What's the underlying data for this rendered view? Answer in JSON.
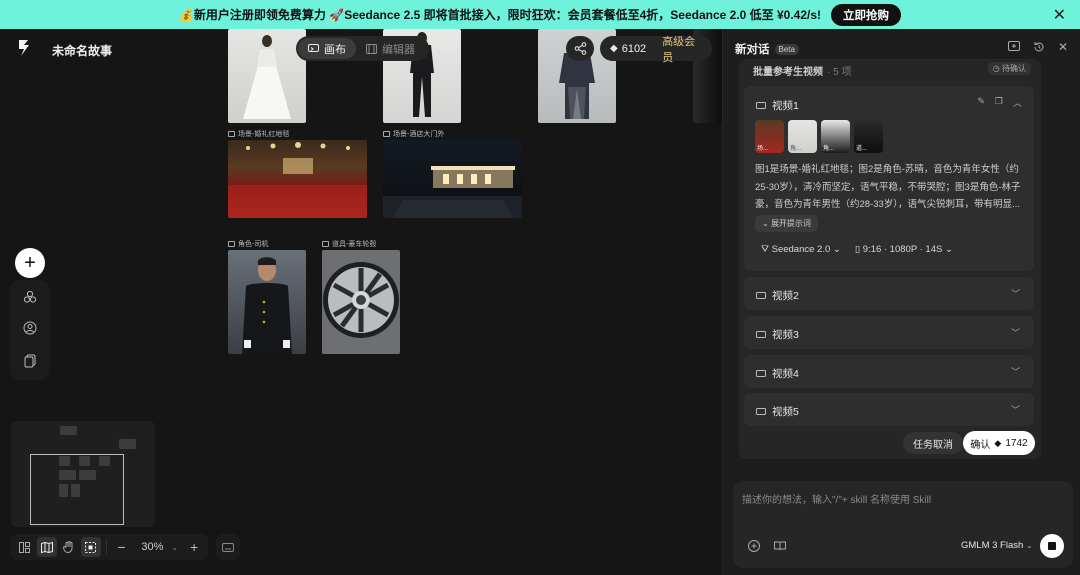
{
  "banner": {
    "text": "💰新用户注册即领免费算力 🚀Seedance 2.5 即将首批接入，限时狂欢：会员套餐低至4折，Seedance 2.0 低至 ¥0.42/s!",
    "cta": "立即抢购",
    "accent": "#6ff2dc"
  },
  "header": {
    "project_title": "未命名故事",
    "tabs": [
      {
        "label": "画布",
        "active": true
      },
      {
        "label": "编辑器",
        "active": false
      }
    ],
    "credits": "6102",
    "vip_label": "高级会员"
  },
  "canvas": {
    "assets": [
      {
        "label": "场景-婚礼红地毯"
      },
      {
        "label": "场景-酒店大门外"
      },
      {
        "label": "角色-司机"
      },
      {
        "label": "道具-豪车轮毂"
      }
    ]
  },
  "toolbar": {
    "zoom": "30%"
  },
  "panel": {
    "title": "新对话",
    "badge": "Beta",
    "card_title": "批量参考生视频",
    "card_count": "· 5 项",
    "card_status": "待确认",
    "videos": [
      {
        "label": "视频1",
        "thumb_labels": [
          "场...",
          "角...",
          "角...",
          "道..."
        ],
        "prompt": "图1是场景-婚礼红地毯；图2是角色-苏晴，音色为青年女性（约25-30岁），清冷而坚定，语气平稳，不带哭腔；图3是角色-林子豪，音色为青年男性（约28-33岁），语气尖锐刺耳，带有明显...",
        "expand_label": "展开提示词",
        "model": "Seedance 2.0",
        "spec": "9:16 · 1080P · 14S"
      },
      {
        "label": "视频2"
      },
      {
        "label": "视频3"
      },
      {
        "label": "视频4"
      },
      {
        "label": "视频5"
      }
    ],
    "cancel_label": "任务取消",
    "confirm_label": "确认",
    "confirm_cost": "1742",
    "input_placeholder": "描述你的想法，输入\"/\"+ skill 名称使用 Skill",
    "model_selector": "GMLM 3 Flash"
  }
}
